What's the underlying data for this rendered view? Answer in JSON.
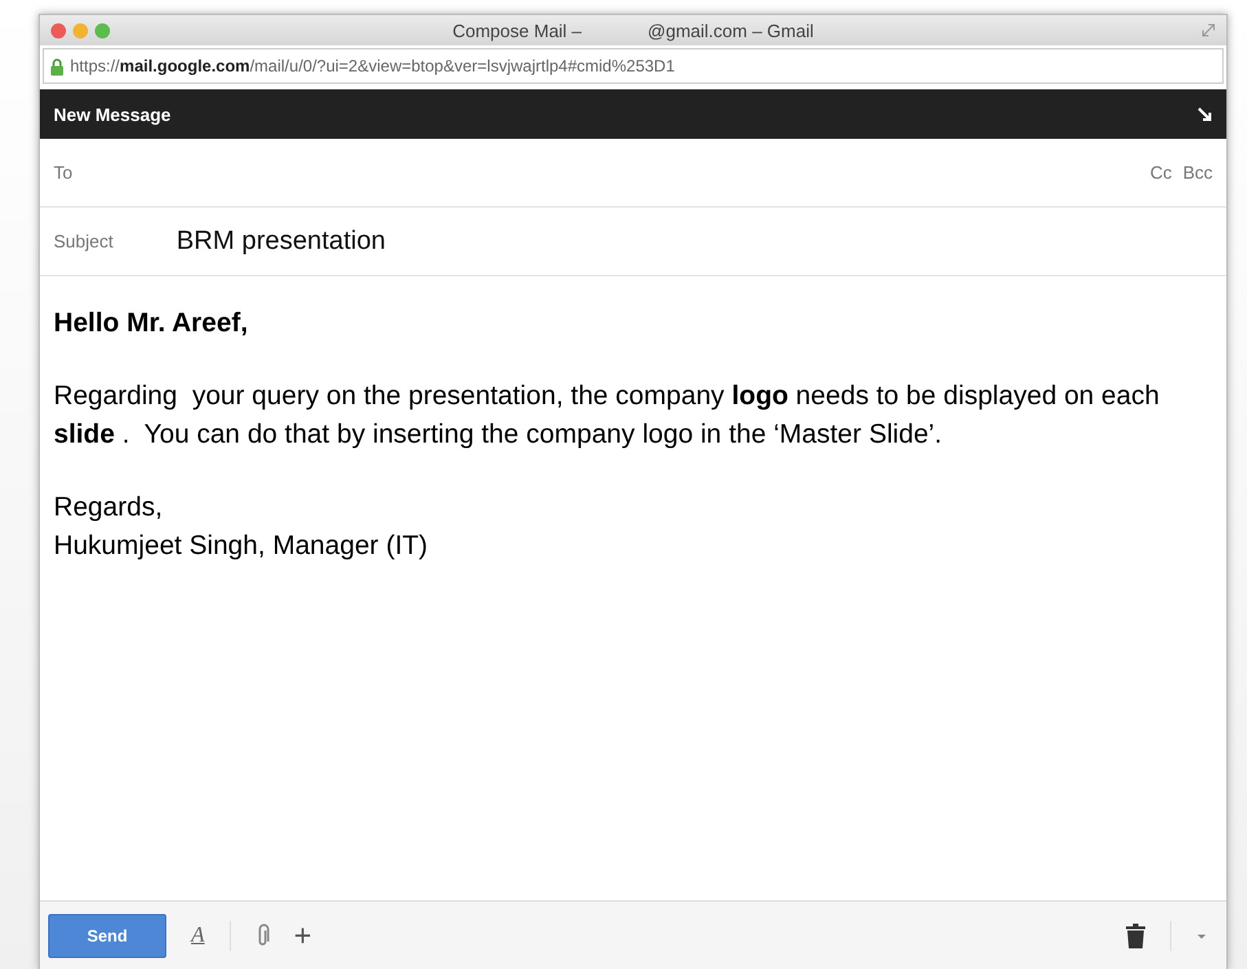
{
  "window": {
    "title_start": "Compose Mail –",
    "title_end": "@gmail.com – Gmail"
  },
  "address_bar": {
    "url": "https://**mail.google.com**/mail/u/0/?ui=2&view=btop&ver=lsvjwajrtlp4#cmid%253D1"
  },
  "compose": {
    "header": "New Message",
    "to_label": "To",
    "cc": "Cc",
    "bcc": "Bcc",
    "subject_label": "Subject",
    "subject": "BRM presentation",
    "body": [
      {
        "kind": "greeting",
        "text": "Hello Mr. Areef,"
      },
      {
        "kind": "paragraph",
        "text": "Regarding  your query on the presentation, the company **logo** needs to be displayed on each **slide** .  You can do that by inserting the company logo in the ‘Master Slide’."
      },
      {
        "kind": "signature",
        "lines": [
          "Regards,",
          "Hukumjeet Singh, Manager (IT)"
        ]
      }
    ],
    "send": "Send",
    "formatting": "A",
    "attach": "+"
  }
}
